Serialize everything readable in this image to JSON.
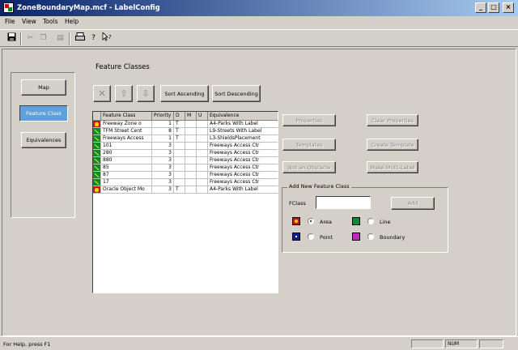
{
  "window": {
    "title": "ZoneBoundaryMap.mcf - LabelConfig"
  },
  "menu": [
    "File",
    "View",
    "Tools",
    "Help"
  ],
  "nav": {
    "map": "Map",
    "feature_class": "Feature Class",
    "equivalences": "Equivalences"
  },
  "heading": "Feature Classes",
  "sort_buttons": {
    "ascending": "Sort Ascending",
    "descending": "Sort Descending"
  },
  "grid": {
    "columns": [
      "Feature Class",
      "Priority",
      "D",
      "M",
      "U",
      "Equivalence"
    ],
    "rows": [
      {
        "icon": "area",
        "name": "Freeway Zone o",
        "priority": "1",
        "d": "T",
        "m": "",
        "u": "",
        "equivalence": "A4-Parks With Label"
      },
      {
        "icon": "line",
        "name": "TFM Street Cent",
        "priority": "8",
        "d": "T",
        "m": "",
        "u": "",
        "equivalence": "L9-Streets With Label"
      },
      {
        "icon": "line",
        "name": "Freeways Access",
        "priority": "1",
        "d": "T",
        "m": "",
        "u": "",
        "equivalence": "L3-ShieldsPlacement"
      },
      {
        "icon": "line",
        "name": "101",
        "priority": "3",
        "d": "",
        "m": "",
        "u": "",
        "equivalence": "Freeways Access Ctr"
      },
      {
        "icon": "line",
        "name": "280",
        "priority": "3",
        "d": "",
        "m": "",
        "u": "",
        "equivalence": "Freeways Access Ctr"
      },
      {
        "icon": "line",
        "name": "880",
        "priority": "3",
        "d": "",
        "m": "",
        "u": "",
        "equivalence": "Freeways Access Ctr"
      },
      {
        "icon": "line",
        "name": "85",
        "priority": "3",
        "d": "",
        "m": "",
        "u": "",
        "equivalence": "Freeways Access Ctr"
      },
      {
        "icon": "line",
        "name": "87",
        "priority": "3",
        "d": "",
        "m": "",
        "u": "",
        "equivalence": "Freeways Access Ctr"
      },
      {
        "icon": "line",
        "name": "17",
        "priority": "3",
        "d": "",
        "m": "",
        "u": "",
        "equivalence": "Freeways Access Ctr"
      },
      {
        "icon": "area",
        "name": "Oracle Object Mo",
        "priority": "3",
        "d": "T",
        "m": "",
        "u": "",
        "equivalence": "A4-Parks With Label"
      }
    ]
  },
  "actions": {
    "properties": "Properties",
    "clear_properties": "Clear Properties",
    "templates": "Templates",
    "create_template": "Create Template",
    "not_an_obstacle": "Not an Obstacle",
    "make_multi_label": "Make Multi-Label"
  },
  "add_new": {
    "label": "Add New Feature Class",
    "fclass_label": "FClass",
    "fclass_value": "",
    "add_button": "Add",
    "types": [
      {
        "label": "Area",
        "icon": "area-icon",
        "checked": true
      },
      {
        "label": "Line",
        "icon": "line-icon",
        "checked": false
      },
      {
        "label": "Point",
        "icon": "point-icon",
        "checked": false
      },
      {
        "label": "Boundary",
        "icon": "boundary-icon",
        "checked": false
      }
    ]
  },
  "status": {
    "help": "For Help, press F1",
    "num": "NUM"
  }
}
